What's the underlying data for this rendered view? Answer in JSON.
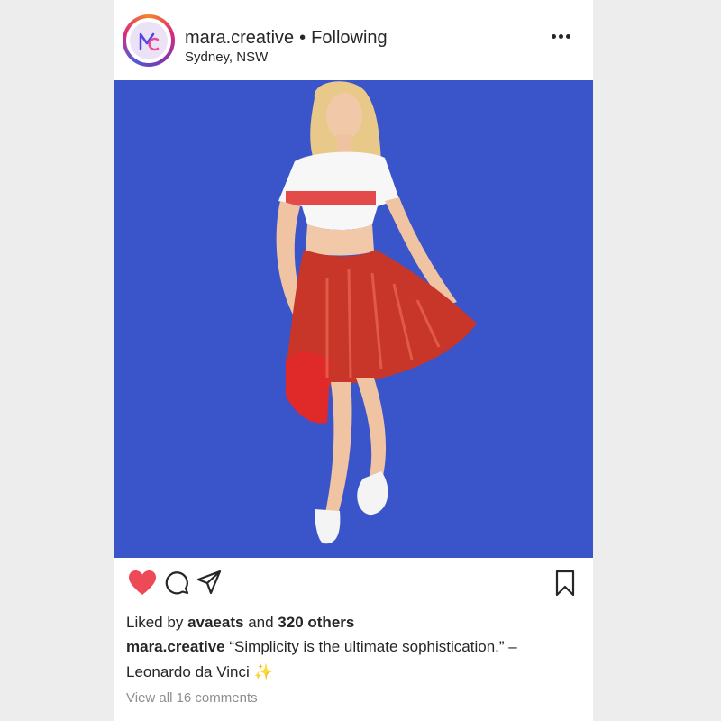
{
  "header": {
    "username": "mara.creative",
    "separator": "•",
    "follow_status": "Following",
    "location": "Sydney, NSW"
  },
  "post": {
    "photo_background": "#3a55c9",
    "liked": true,
    "like_color": "#ed4956"
  },
  "likes": {
    "prefix": "Liked by",
    "liker": "avaeats",
    "joiner": "and",
    "others": "320 others"
  },
  "caption": {
    "author": "mara.creative",
    "text": "“Simplicity is the ultimate sophistication.” – Leonardo da Vinci ✨"
  },
  "comments": {
    "view_all": "View all 16 comments"
  }
}
